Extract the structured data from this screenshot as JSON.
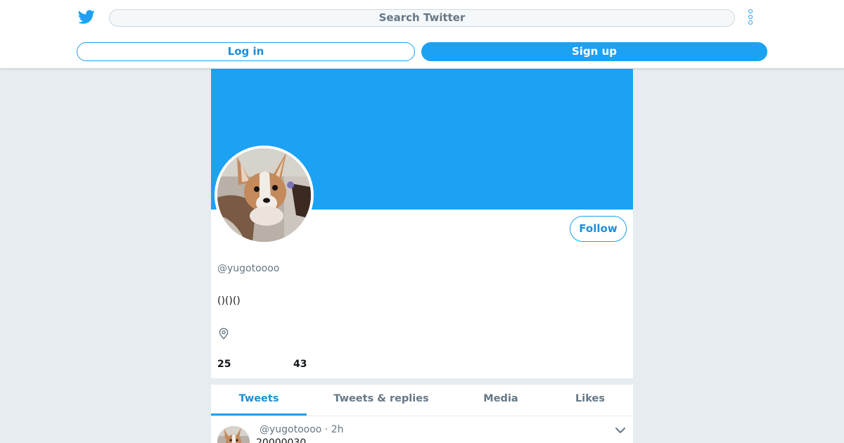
{
  "header": {
    "logo_icon": "twitter-bird-icon",
    "search_placeholder": "Search Twitter",
    "more_icon": "more-vertical-icon",
    "login_label": "Log in",
    "signup_label": "Sign up"
  },
  "colors": {
    "brand": "#1da1f2",
    "page_background": "#e6ecf0",
    "secondary_text": "#657786"
  },
  "profile": {
    "handle": "@yugotoooo",
    "bio": "()()()",
    "location_icon": "location-pin-icon",
    "follow_label": "Follow",
    "stats": [
      {
        "value": "25"
      },
      {
        "value": "43"
      }
    ]
  },
  "tabs": [
    {
      "label": "Tweets",
      "active": true
    },
    {
      "label": "Tweets & replies",
      "active": false
    },
    {
      "label": "Media",
      "active": false
    },
    {
      "label": "Likes",
      "active": false
    }
  ],
  "tweet": {
    "handle": "@yugotoooo",
    "time": "2h",
    "meta": "@yugotoooo · 2h",
    "text": "20000030",
    "menu_icon": "chevron-down-icon"
  }
}
